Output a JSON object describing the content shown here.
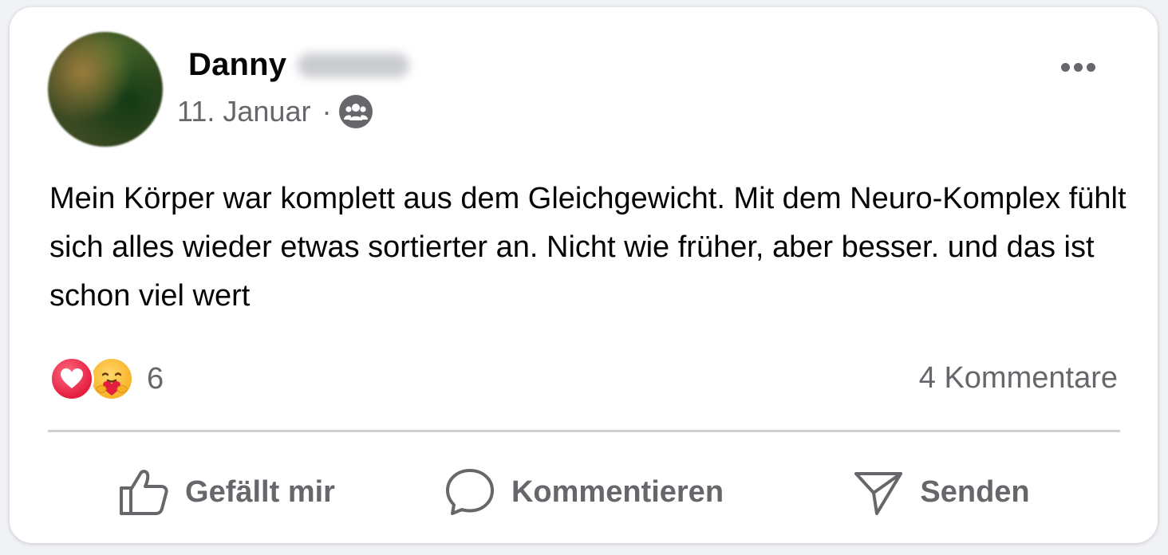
{
  "post": {
    "author_name": "Danny",
    "date": "11. Januar",
    "separator": "·",
    "audience_icon": "group-icon",
    "text": "Mein Körper war komplett aus dem Gleichgewicht. Mit dem Neuro-Komplex fühlt sich alles wieder etwas sortierter an. Nicht wie früher, aber besser. und das ist schon viel wert"
  },
  "reactions": {
    "types": [
      "love",
      "care"
    ],
    "count": "6"
  },
  "comments_label": "4 Kommentare",
  "actions": {
    "like_label": "Gefällt mir",
    "comment_label": "Kommentieren",
    "send_label": "Senden"
  },
  "colors": {
    "text_primary": "#050505",
    "text_secondary": "#65676b",
    "love_red": "#e41e3f",
    "care_yellow": "#f7b125"
  }
}
